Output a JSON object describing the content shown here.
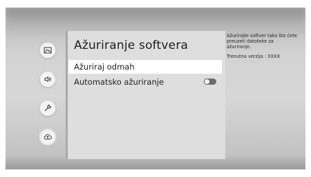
{
  "settings": {
    "title": "Ažuriranje softvera",
    "items": [
      {
        "label": "Ažuriraj odmah",
        "focused": true
      },
      {
        "label": "Automatsko ažuriranje",
        "toggle": false
      }
    ]
  },
  "description": {
    "text": "Ažurirajte softver tako što ćete preuzeti datoteke za ažuriranje.",
    "version": "Trenutna verzija : XXXX"
  },
  "nav": [
    {
      "icon": "picture-icon"
    },
    {
      "icon": "sound-icon"
    },
    {
      "icon": "wrench-icon"
    },
    {
      "icon": "cloud-update-icon",
      "active": true
    }
  ],
  "colors": {
    "panel": "#dedede",
    "focus": "#ffffff",
    "toggle_track": "#6c6c6c"
  }
}
